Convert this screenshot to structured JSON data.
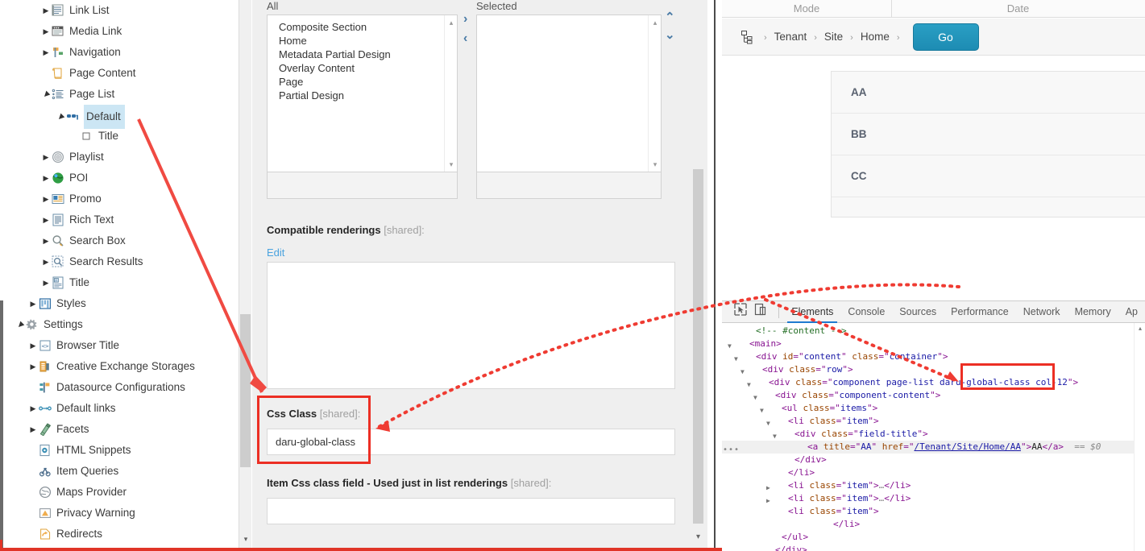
{
  "tree": {
    "items": [
      {
        "label": "Link List",
        "icon": "link-list-icon",
        "expander": "collapsed",
        "indent": 68,
        "selected": false
      },
      {
        "label": "Media Link",
        "icon": "media-link-icon",
        "expander": "collapsed",
        "indent": 68,
        "selected": false
      },
      {
        "label": "Navigation",
        "icon": "navigation-icon",
        "expander": "collapsed",
        "indent": 68,
        "selected": false
      },
      {
        "label": "Page Content",
        "icon": "page-content-icon",
        "expander": "none",
        "indent": 68,
        "selected": false
      },
      {
        "label": "Page List",
        "icon": "page-list-icon",
        "expander": "expanded",
        "indent": 68,
        "selected": false
      },
      {
        "label": "Default",
        "icon": "rendering-icon",
        "expander": "expanded",
        "indent": 86,
        "selected": true
      },
      {
        "label": "Title",
        "icon": "field-icon",
        "expander": "none",
        "indent": 104,
        "selected": false
      },
      {
        "label": "Playlist",
        "icon": "playlist-icon",
        "expander": "collapsed",
        "indent": 68,
        "selected": false
      },
      {
        "label": "POI",
        "icon": "poi-icon",
        "expander": "collapsed",
        "indent": 68,
        "selected": false
      },
      {
        "label": "Promo",
        "icon": "promo-icon",
        "expander": "collapsed",
        "indent": 68,
        "selected": false
      },
      {
        "label": "Rich Text",
        "icon": "rich-text-icon",
        "expander": "collapsed",
        "indent": 68,
        "selected": false
      },
      {
        "label": "Search Box",
        "icon": "search-box-icon",
        "expander": "collapsed",
        "indent": 68,
        "selected": false
      },
      {
        "label": "Search Results",
        "icon": "search-results-icon",
        "expander": "collapsed",
        "indent": 68,
        "selected": false
      },
      {
        "label": "Title",
        "icon": "title-icon",
        "expander": "collapsed",
        "indent": 68,
        "selected": false
      },
      {
        "label": "Styles",
        "icon": "styles-icon",
        "expander": "collapsed",
        "indent": 52,
        "selected": false
      },
      {
        "label": "Settings",
        "icon": "settings-icon",
        "expander": "expanded",
        "indent": 36,
        "selected": false
      },
      {
        "label": "Browser Title",
        "icon": "browser-title-icon",
        "expander": "collapsed",
        "indent": 52,
        "selected": false
      },
      {
        "label": "Creative Exchange Storages",
        "icon": "creative-exchange-icon",
        "expander": "collapsed",
        "indent": 52,
        "selected": false
      },
      {
        "label": "Datasource Configurations",
        "icon": "datasource-icon",
        "expander": "none",
        "indent": 52,
        "selected": false
      },
      {
        "label": "Default links",
        "icon": "default-links-icon",
        "expander": "collapsed",
        "indent": 52,
        "selected": false
      },
      {
        "label": "Facets",
        "icon": "facets-icon",
        "expander": "collapsed",
        "indent": 52,
        "selected": false
      },
      {
        "label": "HTML Snippets",
        "icon": "html-snippets-icon",
        "expander": "none",
        "indent": 52,
        "selected": false
      },
      {
        "label": "Item Queries",
        "icon": "item-queries-icon",
        "expander": "none",
        "indent": 52,
        "selected": false
      },
      {
        "label": "Maps Provider",
        "icon": "maps-provider-icon",
        "expander": "none",
        "indent": 52,
        "selected": false
      },
      {
        "label": "Privacy Warning",
        "icon": "privacy-warning-icon",
        "expander": "none",
        "indent": 52,
        "selected": false
      },
      {
        "label": "Redirects",
        "icon": "redirects-icon",
        "expander": "none",
        "indent": 52,
        "selected": false
      }
    ]
  },
  "form": {
    "all_label": "All",
    "selected_label": "Selected",
    "all_items": [
      "Composite Section",
      "Home",
      "Metadata Partial Design",
      "Overlay Content",
      "Page",
      "Partial Design"
    ],
    "selected_items": [],
    "move_right": "›",
    "move_left": "‹",
    "move_up": "⌃",
    "move_down": "⌄",
    "compatible_renderings_label": "Compatible renderings",
    "compatible_renderings_shared": "[shared]:",
    "edit_link": "Edit",
    "css_class_label": "Css Class",
    "css_class_shared": "[shared]:",
    "css_class_value": "daru-global-class",
    "item_css_label": "Item Css class field - Used just in list renderings",
    "item_css_shared": "[shared]:",
    "item_css_value": ""
  },
  "browser": {
    "grid_headers": [
      "Mode",
      "Date"
    ],
    "breadcrumb": [
      "Tenant",
      "Site",
      "Home"
    ],
    "breadcrumb_sep": "›",
    "go_button": "Go",
    "page_items": [
      "AA",
      "BB",
      "CC"
    ]
  },
  "devtools": {
    "tabs": [
      {
        "label": "Elements",
        "active": true
      },
      {
        "label": "Console",
        "active": false
      },
      {
        "label": "Sources",
        "active": false
      },
      {
        "label": "Performance",
        "active": false
      },
      {
        "label": "Network",
        "active": false
      },
      {
        "label": "Memory",
        "active": false
      },
      {
        "label": "Ap",
        "active": false
      }
    ],
    "dom_lines": [
      {
        "indent": 3,
        "caret": "none",
        "parts": [
          {
            "t": "cmt",
            "s": "<!-- #content -->"
          }
        ]
      },
      {
        "indent": 2,
        "caret": "open",
        "parts": [
          {
            "t": "tag",
            "s": "<main>"
          }
        ]
      },
      {
        "indent": 3,
        "caret": "open",
        "parts": [
          {
            "t": "tag",
            "s": "<div "
          },
          {
            "t": "attr",
            "s": "id"
          },
          {
            "t": "tag",
            "s": "=\""
          },
          {
            "t": "val",
            "s": "content"
          },
          {
            "t": "tag",
            "s": "\" "
          },
          {
            "t": "attr",
            "s": "class"
          },
          {
            "t": "tag",
            "s": "=\""
          },
          {
            "t": "val",
            "s": "container"
          },
          {
            "t": "tag",
            "s": "\">"
          }
        ]
      },
      {
        "indent": 4,
        "caret": "open",
        "parts": [
          {
            "t": "tag",
            "s": "<div "
          },
          {
            "t": "attr",
            "s": "class"
          },
          {
            "t": "tag",
            "s": "=\""
          },
          {
            "t": "val",
            "s": "row"
          },
          {
            "t": "tag",
            "s": "\">"
          }
        ]
      },
      {
        "indent": 5,
        "caret": "open",
        "parts": [
          {
            "t": "tag",
            "s": "<div "
          },
          {
            "t": "attr",
            "s": "class"
          },
          {
            "t": "tag",
            "s": "=\""
          },
          {
            "t": "val",
            "s": "component page-list daru-global-class col-12"
          },
          {
            "t": "tag",
            "s": "\">"
          }
        ]
      },
      {
        "indent": 6,
        "caret": "open",
        "parts": [
          {
            "t": "tag",
            "s": "<div "
          },
          {
            "t": "attr",
            "s": "class"
          },
          {
            "t": "tag",
            "s": "=\""
          },
          {
            "t": "val",
            "s": "component-content"
          },
          {
            "t": "tag",
            "s": "\">"
          }
        ]
      },
      {
        "indent": 7,
        "caret": "open",
        "parts": [
          {
            "t": "tag",
            "s": "<ul "
          },
          {
            "t": "attr",
            "s": "class"
          },
          {
            "t": "tag",
            "s": "=\""
          },
          {
            "t": "val",
            "s": "items"
          },
          {
            "t": "tag",
            "s": "\">"
          }
        ]
      },
      {
        "indent": 8,
        "caret": "open",
        "parts": [
          {
            "t": "tag",
            "s": "<li "
          },
          {
            "t": "attr",
            "s": "class"
          },
          {
            "t": "tag",
            "s": "=\""
          },
          {
            "t": "val",
            "s": "item"
          },
          {
            "t": "tag",
            "s": "\">"
          }
        ]
      },
      {
        "indent": 9,
        "caret": "open",
        "parts": [
          {
            "t": "tag",
            "s": "<div "
          },
          {
            "t": "attr",
            "s": "class"
          },
          {
            "t": "tag",
            "s": "=\""
          },
          {
            "t": "val",
            "s": "field-title"
          },
          {
            "t": "tag",
            "s": "\">"
          }
        ]
      },
      {
        "indent": 11,
        "caret": "dots",
        "highlight": true,
        "parts": [
          {
            "t": "tag",
            "s": "<a "
          },
          {
            "t": "attr",
            "s": "title"
          },
          {
            "t": "tag",
            "s": "=\""
          },
          {
            "t": "val",
            "s": "AA"
          },
          {
            "t": "tag",
            "s": "\" "
          },
          {
            "t": "attr",
            "s": "href"
          },
          {
            "t": "tag",
            "s": "=\""
          },
          {
            "t": "lnk",
            "s": "/Tenant/Site/Home/AA"
          },
          {
            "t": "tag",
            "s": "\">"
          },
          {
            "t": "txtn",
            "s": "AA"
          },
          {
            "t": "tag",
            "s": "</a>"
          },
          {
            "t": "sel0",
            "s": "  == $0"
          }
        ]
      },
      {
        "indent": 9,
        "caret": "none",
        "parts": [
          {
            "t": "tag",
            "s": "</div>"
          }
        ]
      },
      {
        "indent": 8,
        "caret": "none",
        "parts": [
          {
            "t": "tag",
            "s": "</li>"
          }
        ]
      },
      {
        "indent": 8,
        "caret": "closed",
        "parts": [
          {
            "t": "tag",
            "s": "<li "
          },
          {
            "t": "attr",
            "s": "class"
          },
          {
            "t": "tag",
            "s": "=\""
          },
          {
            "t": "val",
            "s": "item"
          },
          {
            "t": "tag",
            "s": "\">"
          },
          {
            "t": "ell",
            "s": "…"
          },
          {
            "t": "tag",
            "s": "</li>"
          }
        ]
      },
      {
        "indent": 8,
        "caret": "closed",
        "parts": [
          {
            "t": "tag",
            "s": "<li "
          },
          {
            "t": "attr",
            "s": "class"
          },
          {
            "t": "tag",
            "s": "=\""
          },
          {
            "t": "val",
            "s": "item"
          },
          {
            "t": "tag",
            "s": "\">"
          },
          {
            "t": "ell",
            "s": "…"
          },
          {
            "t": "tag",
            "s": "</li>"
          }
        ]
      },
      {
        "indent": 8,
        "caret": "none",
        "parts": [
          {
            "t": "tag",
            "s": "<li "
          },
          {
            "t": "attr",
            "s": "class"
          },
          {
            "t": "tag",
            "s": "=\""
          },
          {
            "t": "val",
            "s": "item"
          },
          {
            "t": "tag",
            "s": "\">"
          }
        ]
      },
      {
        "indent": 15,
        "caret": "none",
        "parts": [
          {
            "t": "tag",
            "s": "</li>"
          }
        ]
      },
      {
        "indent": 7,
        "caret": "none",
        "parts": [
          {
            "t": "tag",
            "s": "</ul>"
          }
        ]
      },
      {
        "indent": 6,
        "caret": "none",
        "parts": [
          {
            "t": "tag",
            "s": "</div>"
          }
        ]
      }
    ]
  },
  "annotations": {
    "accent_color": "#ec2f24",
    "highlight_css_class_box": true,
    "highlight_dom_class_box": true
  }
}
